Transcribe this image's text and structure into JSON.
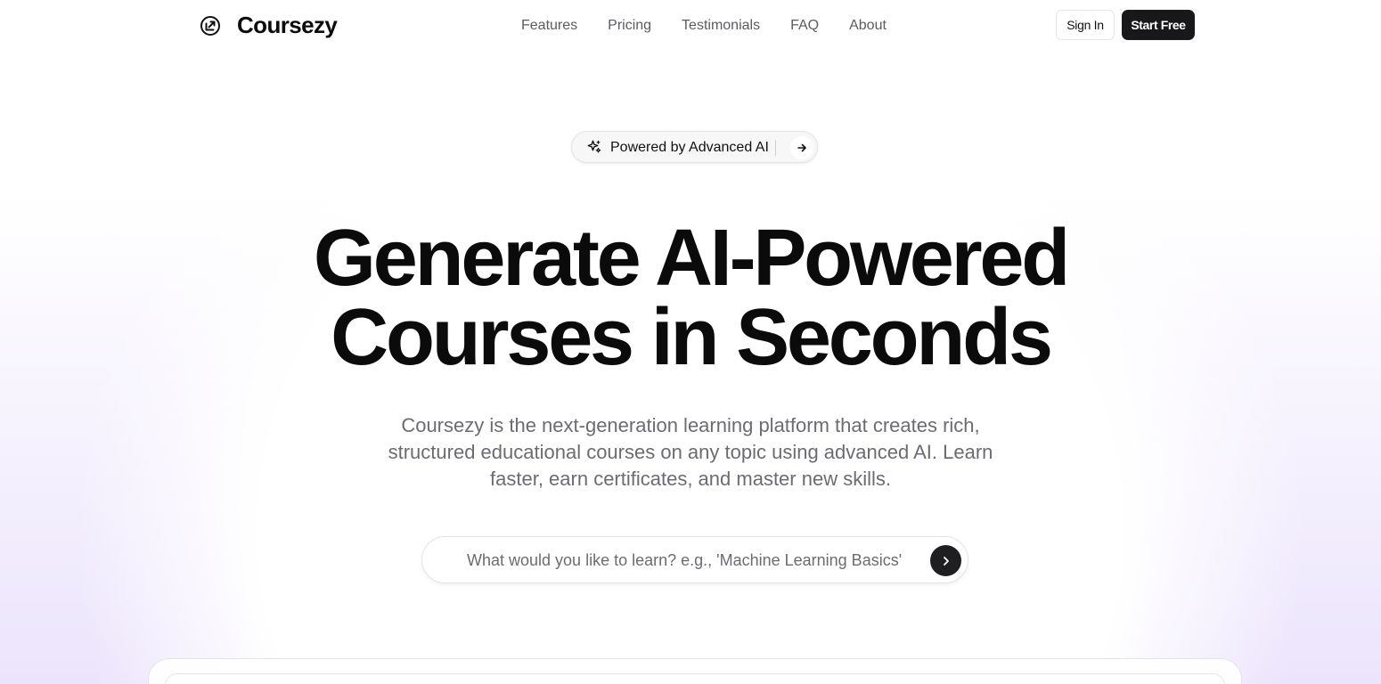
{
  "header": {
    "brand_name": "Coursezy",
    "brand_icon": "coursezy-logo-icon",
    "nav": [
      {
        "label": "Features"
      },
      {
        "label": "Pricing"
      },
      {
        "label": "Testimonials"
      },
      {
        "label": "FAQ"
      },
      {
        "label": "About"
      }
    ],
    "sign_in_label": "Sign In",
    "start_free_label": "Start Free"
  },
  "badge": {
    "icon": "sparkle-icon",
    "text": "Powered by Advanced AI",
    "arrow_icon": "arrow-right-icon"
  },
  "hero": {
    "title_line1": "Generate AI-Powered",
    "title_line2": "Courses in Seconds",
    "subtitle": "Coursezy is the next-generation learning platform that creates rich, structured educational courses on any topic using advanced AI. Learn faster, earn certificates, and master new skills."
  },
  "search": {
    "value": "",
    "placeholder": "What would you like to learn? e.g., 'Machine Learning Basics'",
    "submit_icon": "chevron-right-icon"
  },
  "colors": {
    "primary": "#18181b",
    "text_muted": "#6b6b75",
    "accent_glow": "#d4c4f8"
  }
}
